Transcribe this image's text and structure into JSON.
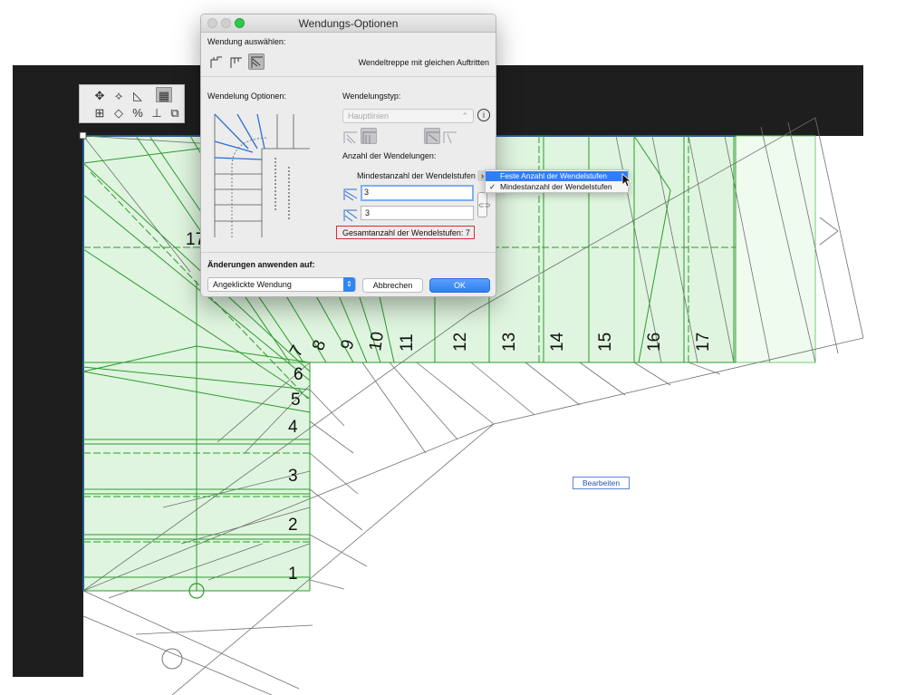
{
  "dialog": {
    "title": "Wendungs-Optionen",
    "select_turn_label": "Wendung auswählen:",
    "stair_type_text": "Wendeltreppe mit gleichen Auftritten",
    "options_label": "Wendelung Optionen:",
    "type_label": "Wendelungstyp:",
    "type_value": "Hauptlinien",
    "count_label": "Anzahl der Wendelungen:",
    "mode_label": "Mindestanzahl der Wendelstufen",
    "field1_value": "3",
    "field2_value": "3",
    "total_text": "Gesamtanzahl der Wendelstufen: 7",
    "apply_label": "Änderungen anwenden auf:",
    "apply_value": "Angeklickte Wendung",
    "cancel_label": "Abbrechen",
    "ok_label": "OK"
  },
  "menu": {
    "items": [
      {
        "label": "Feste Anzahl der Wendelstufen",
        "highlighted": true,
        "checked": false
      },
      {
        "label": "Mindestanzahl der Wendelstufen",
        "highlighted": false,
        "checked": true
      }
    ],
    "check_mark": "✓"
  },
  "canvas": {
    "edit_label": "Bearbeiten",
    "step_numbers_left": [
      "1",
      "2",
      "3",
      "4",
      "5",
      "6"
    ],
    "step_numbers_diag": [
      "7",
      "8",
      "9",
      "10",
      "11",
      "12",
      "13",
      "14",
      "15",
      "16",
      "17"
    ],
    "partial_label": "17"
  },
  "icons": [
    "move-icon",
    "rotate-icon",
    "shape-icon",
    "grid-icon",
    "info-icon",
    "link-icon",
    "cursor-icon",
    "arrow-icon"
  ],
  "colors": {
    "accent": "#2f7ef5",
    "stair_fill": "#dff5df",
    "stair_line": "#2e9a2e",
    "wall": "#1e1e1e",
    "outline_blue": "#1a1aff",
    "total_border": "#d23030"
  }
}
